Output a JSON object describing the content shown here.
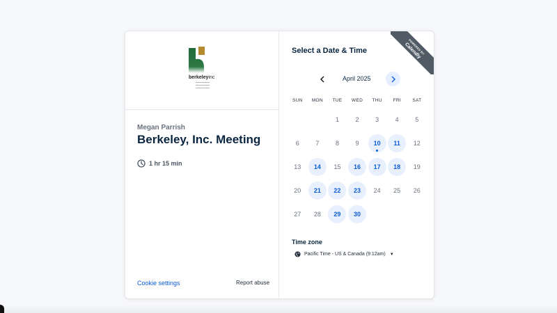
{
  "brand": {
    "logo_name": "berkeley",
    "logo_suffix": "inc",
    "ribbon_small": "POWERED BY",
    "ribbon_big": "Calendly",
    "logo_colors": {
      "gold": "#b58a2e",
      "green": "#1f6b3a"
    }
  },
  "event": {
    "host": "Megan Parrish",
    "title": "Berkeley, Inc. Meeting",
    "duration": "1 hr 15 min",
    "duration_icon": "clock-icon"
  },
  "footer": {
    "cookie_settings": "Cookie settings",
    "report_abuse": "Report abuse"
  },
  "calendar": {
    "heading": "Select a Date & Time",
    "month": "April 2025",
    "prev_icon": "chevron-left-icon",
    "next_icon": "chevron-right-icon",
    "weekdays": [
      "SUN",
      "MON",
      "TUE",
      "WED",
      "THU",
      "FRI",
      "SAT"
    ],
    "weeks": [
      [
        {
          "d": ""
        },
        {
          "d": ""
        },
        {
          "d": "1"
        },
        {
          "d": "2"
        },
        {
          "d": "3"
        },
        {
          "d": "4"
        },
        {
          "d": "5"
        }
      ],
      [
        {
          "d": "6"
        },
        {
          "d": "7"
        },
        {
          "d": "8"
        },
        {
          "d": "9"
        },
        {
          "d": "10",
          "available": true,
          "today": true
        },
        {
          "d": "11",
          "available": true
        },
        {
          "d": "12"
        }
      ],
      [
        {
          "d": "13"
        },
        {
          "d": "14",
          "available": true
        },
        {
          "d": "15"
        },
        {
          "d": "16",
          "available": true
        },
        {
          "d": "17",
          "available": true
        },
        {
          "d": "18",
          "available": true
        },
        {
          "d": "19"
        }
      ],
      [
        {
          "d": "20"
        },
        {
          "d": "21",
          "available": true
        },
        {
          "d": "22",
          "available": true
        },
        {
          "d": "23",
          "available": true
        },
        {
          "d": "24"
        },
        {
          "d": "25"
        },
        {
          "d": "26"
        }
      ],
      [
        {
          "d": "27"
        },
        {
          "d": "28"
        },
        {
          "d": "29",
          "available": true
        },
        {
          "d": "30",
          "available": true
        },
        {
          "d": ""
        },
        {
          "d": ""
        },
        {
          "d": ""
        }
      ]
    ],
    "accent_color": "#0b5cd7",
    "available_bg": "#e8f0fe"
  },
  "timezone": {
    "label": "Time zone",
    "value": "Pacific Time - US & Canada (9:12am)",
    "icon": "globe-icon"
  }
}
